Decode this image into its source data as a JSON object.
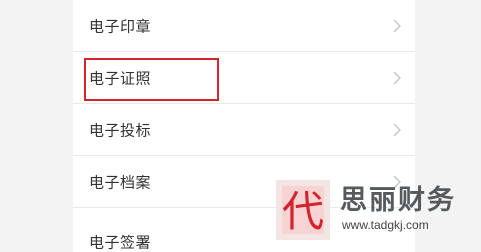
{
  "list": {
    "items": [
      {
        "label": "电子印章"
      },
      {
        "label": "电子证照"
      },
      {
        "label": "电子投标"
      },
      {
        "label": "电子档案"
      },
      {
        "label": "电子签署"
      }
    ]
  },
  "highlight": {
    "target": "电子证照",
    "color": "#d6262d"
  },
  "watermark": {
    "logo_char": "代",
    "brand_name": "思丽财务",
    "url": "www.tadgkj.com"
  },
  "colors": {
    "background": "#f3f3f3",
    "list_bg": "#ffffff",
    "text": "#333333",
    "chevron": "#c2c2c2"
  }
}
